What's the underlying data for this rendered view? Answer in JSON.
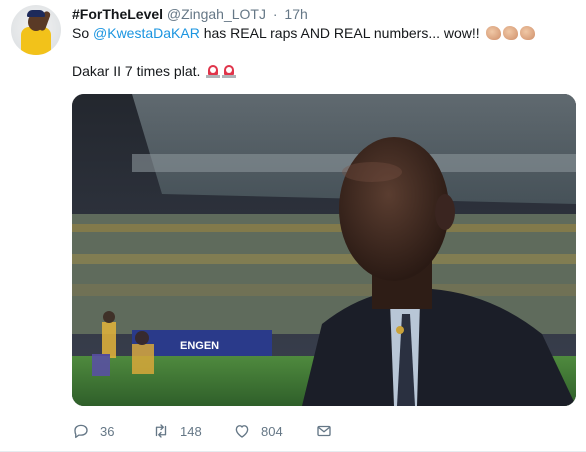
{
  "author": {
    "display_name": "#ForTheLevel",
    "handle": "@Zingah_LOTJ",
    "time": "17h"
  },
  "tweet": {
    "line1_prefix": "So",
    "mention": "@KwestaDaKAR",
    "line1_suffix": "has REAL raps AND REAL numbers... wow!!",
    "line2": "Dakar II 7 times plat.",
    "emoji_line1": [
      "clapping-hands-icon",
      "clapping-hands-icon",
      "clapping-hands-icon"
    ],
    "emoji_line2": [
      "siren-icon",
      "siren-icon"
    ]
  },
  "media": {
    "sign_text": "ENGEN"
  },
  "actions": {
    "replies": "36",
    "retweets": "148",
    "likes": "804"
  },
  "colors": {
    "link": "#1b95e0",
    "secondary_text": "#657786"
  }
}
